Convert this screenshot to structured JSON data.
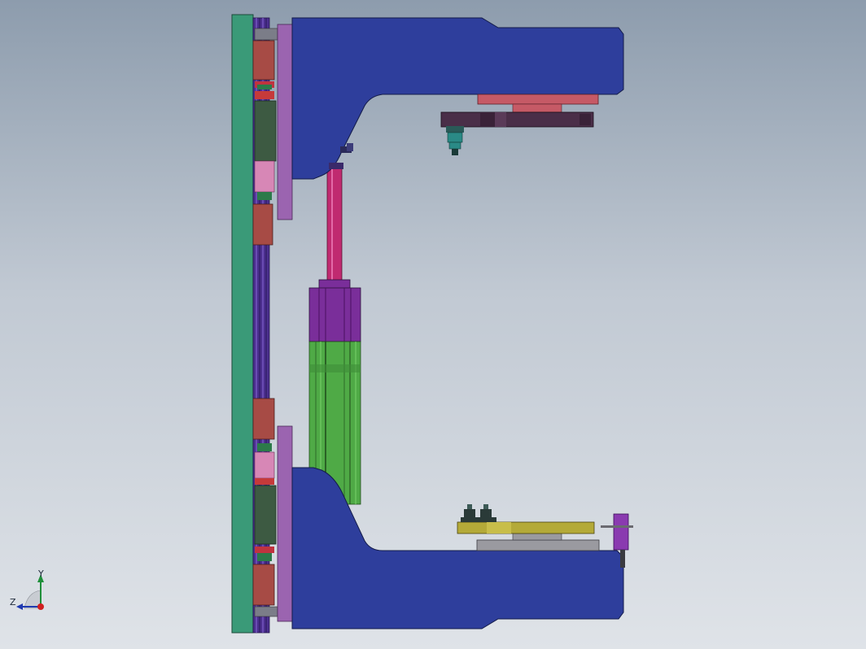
{
  "triad": {
    "y_label": "Y",
    "z_label": "Z"
  },
  "colors": {
    "background_top": "#8d9cad",
    "background_bottom": "#dfe3e8",
    "c_frame": "#2e3e9c",
    "back_plate": "#3a9a78",
    "guide_column": "#5a3aa0",
    "carriage_block": "#a74b45",
    "spacer_plate": "#9b64b0",
    "piston_rod": "#c02a70",
    "cylinder_head": "#7a2e9a",
    "cylinder_body": "#4faa46",
    "upper_tool_plate": "#4a2e48",
    "upper_tool_spacer": "#c65a66",
    "nozzle": "#2a8a86",
    "lower_tool_plate": "#b4aa38",
    "lower_tool_base": "#9a9aa0",
    "clamp_knob": "#2a3a38",
    "side_cylinder": "#8a3ab0"
  }
}
